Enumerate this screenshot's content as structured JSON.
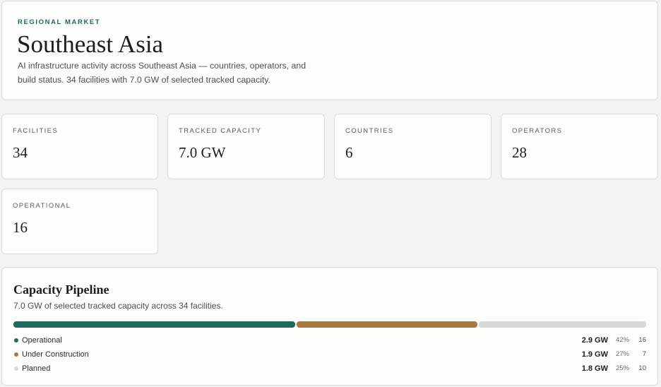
{
  "header": {
    "eyebrow": "REGIONAL MARKET",
    "title": "Southeast Asia",
    "description": "AI infrastructure activity across Southeast Asia — countries, operators, and build status. 34 facilities with 7.0 GW of selected tracked capacity."
  },
  "stats": {
    "facilities": {
      "label": "FACILITIES",
      "value": "34"
    },
    "capacity": {
      "label": "TRACKED CAPACITY",
      "value": "7.0 GW"
    },
    "countries": {
      "label": "COUNTRIES",
      "value": "6"
    },
    "operators": {
      "label": "OPERATORS",
      "value": "28"
    },
    "operational": {
      "label": "OPERATIONAL",
      "value": "16"
    }
  },
  "pipeline": {
    "title": "Capacity Pipeline",
    "subtitle": "7.0 GW of selected tracked capacity across 34 facilities.",
    "segments": [
      {
        "label": "Operational",
        "gw": "2.9 GW",
        "pct": "42%",
        "count": "16",
        "fraction": 0.42,
        "color": "#1e6b5d"
      },
      {
        "label": "Under Construction",
        "gw": "1.9 GW",
        "pct": "27%",
        "count": "7",
        "fraction": 0.27,
        "color": "#a87a3c"
      },
      {
        "label": "Planned",
        "gw": "1.8 GW",
        "pct": "25%",
        "count": "10",
        "fraction": 0.25,
        "color": "#d7d9d4"
      }
    ]
  }
}
